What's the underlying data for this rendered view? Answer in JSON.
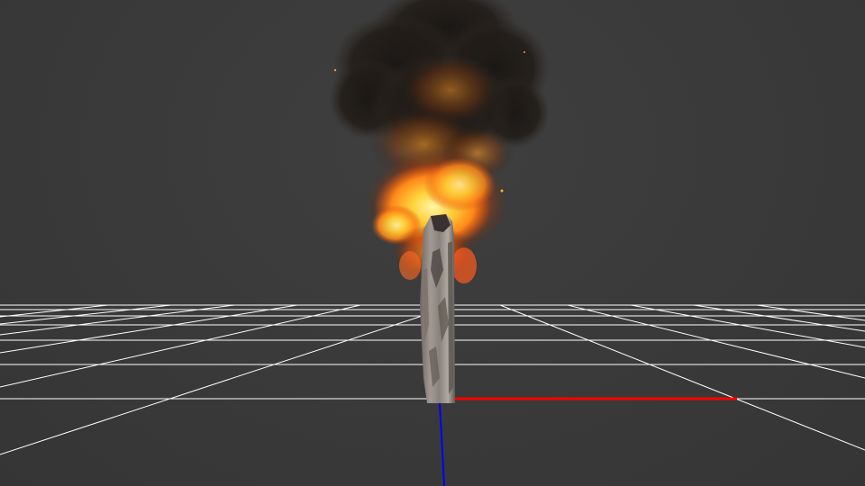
{
  "viewport": {
    "background_color": "#3a3a3a",
    "grid_color": "#ffffff",
    "axis_x_color": "#ff0000",
    "axis_z_color": "#0000ff"
  },
  "scene_objects": [
    {
      "name": "burnt-log",
      "type": "wooden-post",
      "state": "burning"
    },
    {
      "name": "fire-effect",
      "type": "particle-fire",
      "colors": [
        "#ffd23a",
        "#ff8a1a",
        "#d24a10"
      ]
    },
    {
      "name": "smoke-effect",
      "type": "particle-smoke",
      "colors": [
        "#1f1a16",
        "#2a2420"
      ]
    }
  ]
}
